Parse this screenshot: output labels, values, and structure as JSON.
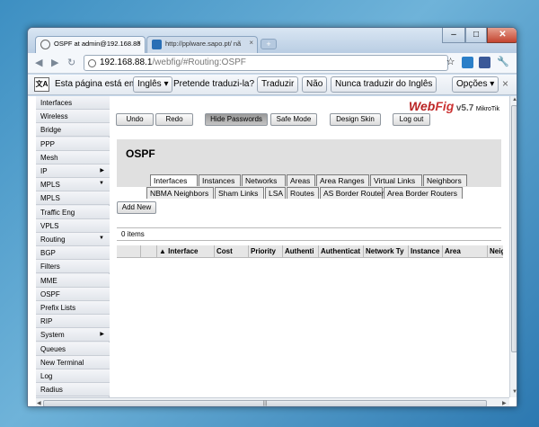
{
  "browser": {
    "tabs": [
      {
        "title": "OSPF at admin@192.168.88",
        "close": "×"
      },
      {
        "title": "http://pplware.sapo.pt/ nã",
        "close": "×"
      }
    ],
    "new_tab_label": "+",
    "controls": {
      "minimize": "–",
      "maximize": "□",
      "close": "✕"
    },
    "nav": {
      "back": "◀",
      "forward": "▶",
      "reload": "↻"
    },
    "url": {
      "host": "192.168.88.1",
      "path": "/webfig/#Routing:OSPF"
    },
    "icons": {
      "star": "☆",
      "wrench": "🔧"
    }
  },
  "translate_bar": {
    "icon_text": "文A",
    "prefix": "Esta página está em",
    "language": "Inglês ▾",
    "question": "Pretende traduzi-la?",
    "translate": "Traduzir",
    "no": "Não",
    "never": "Nunca traduzir do Inglês",
    "options": "Opções ▾",
    "close": "×"
  },
  "sidebar": {
    "items": [
      {
        "label": "Interfaces",
        "arrow": ""
      },
      {
        "label": "Wireless",
        "arrow": ""
      },
      {
        "label": "Bridge",
        "arrow": ""
      },
      {
        "label": "PPP",
        "arrow": ""
      },
      {
        "label": "Mesh",
        "arrow": ""
      },
      {
        "label": "IP",
        "arrow": "▶"
      },
      {
        "label": "MPLS",
        "arrow": "▼"
      },
      {
        "label": "MPLS",
        "arrow": ""
      },
      {
        "label": "Traffic Eng",
        "arrow": ""
      },
      {
        "label": "VPLS",
        "arrow": ""
      },
      {
        "label": "Routing",
        "arrow": "▼"
      },
      {
        "label": "BGP",
        "arrow": ""
      },
      {
        "label": "Filters",
        "arrow": ""
      },
      {
        "label": "MME",
        "arrow": ""
      },
      {
        "label": "OSPF",
        "arrow": ""
      },
      {
        "label": "Prefix Lists",
        "arrow": ""
      },
      {
        "label": "RIP",
        "arrow": ""
      },
      {
        "label": "System",
        "arrow": "▶"
      },
      {
        "label": "Queues",
        "arrow": ""
      },
      {
        "label": "New Terminal",
        "arrow": ""
      },
      {
        "label": "Log",
        "arrow": ""
      },
      {
        "label": "Radius",
        "arrow": ""
      }
    ]
  },
  "logo": {
    "web": "Web",
    "fig": "Fig",
    "version": "v5.7",
    "vendor": "MikroTik"
  },
  "actions": {
    "undo": "Undo",
    "redo": "Redo",
    "hide_passwords": "Hide Passwords",
    "safe_mode": "Safe Mode",
    "design_skin": "Design Skin",
    "log_out": "Log out"
  },
  "panel": {
    "title": "OSPF",
    "tabs_row1": [
      "Interfaces",
      "Instances",
      "Networks",
      "Areas",
      "Area Ranges",
      "Virtual Links",
      "Neighbors"
    ],
    "tabs_row2": [
      "NBMA Neighbors",
      "Sham Links",
      "LSA",
      "Routes",
      "AS Border Routers",
      "Area Border Routers"
    ],
    "active_tab": "Interfaces"
  },
  "add_new": "Add New",
  "items_count": "0 items",
  "table": {
    "columns": [
      "",
      "",
      "▲ Interface",
      "Cost",
      "Priority",
      "Authenti",
      "Authenticat",
      "Network Ty",
      "Instance",
      "Area",
      "Neig"
    ]
  },
  "scrollbar": {
    "grip": "|||"
  }
}
